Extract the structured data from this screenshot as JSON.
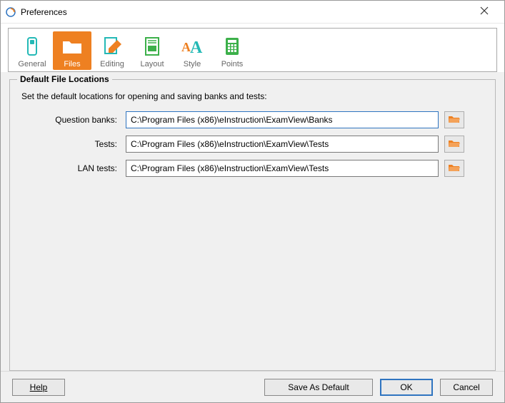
{
  "window": {
    "title": "Preferences"
  },
  "toolbar": {
    "items": [
      {
        "label": "General"
      },
      {
        "label": "Files"
      },
      {
        "label": "Editing"
      },
      {
        "label": "Layout"
      },
      {
        "label": "Style"
      },
      {
        "label": "Points"
      }
    ],
    "active_index": 1
  },
  "group": {
    "title": "Default File Locations",
    "description": "Set the default locations for opening and saving banks and tests:"
  },
  "fields": {
    "question_banks": {
      "label": "Question banks:",
      "value": "C:\\Program Files (x86)\\eInstruction\\ExamView\\Banks"
    },
    "tests": {
      "label": "Tests:",
      "value": "C:\\Program Files (x86)\\eInstruction\\ExamView\\Tests"
    },
    "lan_tests": {
      "label": "LAN tests:",
      "value": "C:\\Program Files (x86)\\eInstruction\\ExamView\\Tests"
    }
  },
  "buttons": {
    "help": "Help",
    "save_default": "Save As Default",
    "ok": "OK",
    "cancel": "Cancel"
  },
  "colors": {
    "accent": "#ee8021",
    "focus": "#2f74c0",
    "teal": "#24b9b6"
  }
}
